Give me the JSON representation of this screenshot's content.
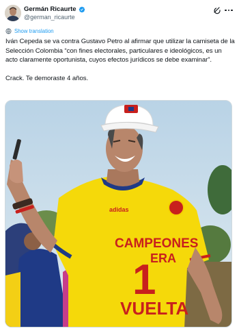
{
  "author": {
    "display_name": "Germán Ricaurte",
    "handle": "@german_ricaurte",
    "verified": true
  },
  "icons": {
    "avatar": "avatar-photo",
    "verified": "verified-badge-icon",
    "grok": "grok-icon",
    "more": "more-options-icon",
    "translate": "translate-icon"
  },
  "translation": {
    "label": "Show translation"
  },
  "tweet": {
    "paragraph_1": "Iván Cepeda se va contra Gustavo Petro al afirmar que utilizar la camiseta de la Selección Colombia “con fines electorales, particulares e ideológicos, es un acto claramente oportunista, cuyos efectos jurídicos se debe examinar”.",
    "paragraph_2": "Crack. Te demoraste 4 años."
  },
  "media": {
    "shirt_text_line_1": "CAMPEONES",
    "shirt_number": "1",
    "shirt_text_line_2": "ERA",
    "shirt_text_line_3": "VUELTA",
    "brand": "adidas"
  },
  "colors": {
    "accent": "#1d9bf0",
    "jersey_yellow": "#f5d90a",
    "jersey_text_red": "#c8201d",
    "text_secondary": "#536471"
  }
}
